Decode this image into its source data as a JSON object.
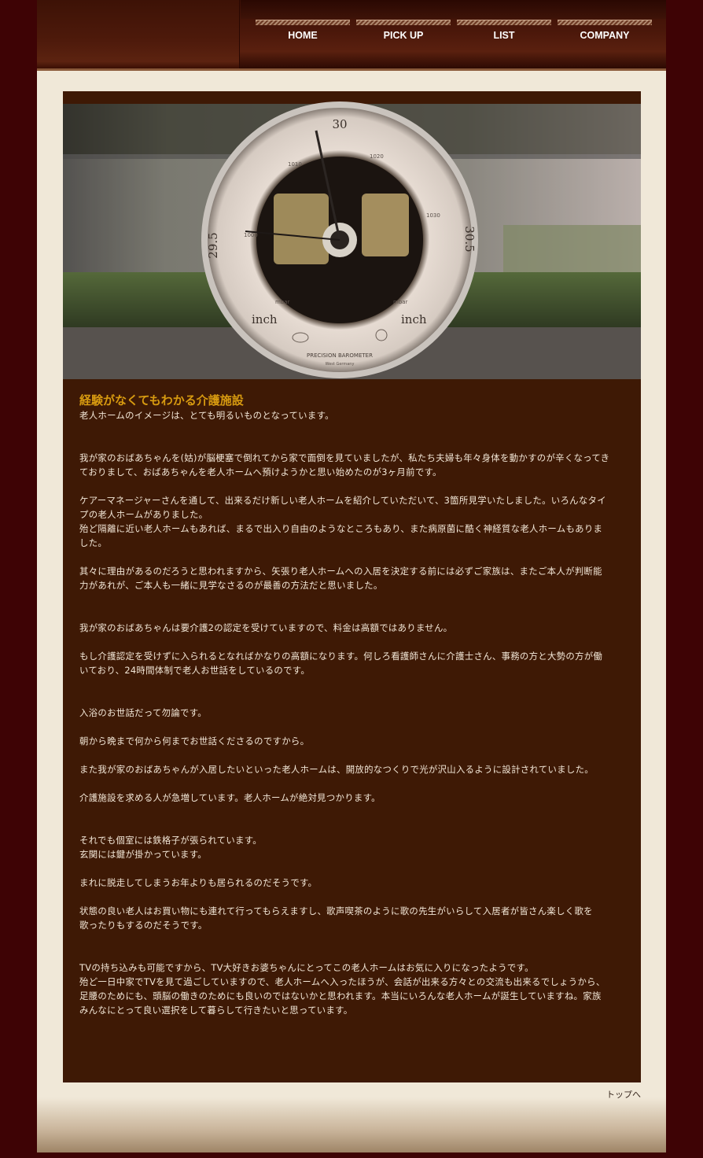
{
  "nav": {
    "items": [
      {
        "label": "HOME"
      },
      {
        "label": "PICK UP"
      },
      {
        "label": "LIST"
      },
      {
        "label": "COMPANY"
      }
    ]
  },
  "hero": {
    "dial_numbers": {
      "n30": "30",
      "n29_5": "29.5",
      "n30_5": "30.5",
      "n1010": "1010",
      "n1020": "1020",
      "n1000": "1000",
      "n1030": "1030"
    },
    "inch_left": "inch",
    "inch_right": "inch",
    "mbar_left": "mbar",
    "mbar_right": "mbar",
    "caption": "PRECISION   BAROMETER",
    "subcaption": "West Germany"
  },
  "content": {
    "title": "経験がなくてもわかる介護施設",
    "intro": "老人ホームのイメージは、とても明るいものとなっています。",
    "p1": [
      "我が家のおばあちゃんを(姑)が脳梗塞で倒れてから家で面倒を見ていましたが、私たち夫婦も年々身体を動かすのが辛くなってき",
      "ておりまして、おばあちゃんを老人ホームへ預けようかと思い始めたのが3ヶ月前です。"
    ],
    "p2": [
      "ケアーマネージャーさんを通して、出来るだけ新しい老人ホームを紹介していただいて、3箇所見学いたしました。いろんなタイ",
      "プの老人ホームがありました。",
      "殆ど隔離に近い老人ホームもあれば、まるで出入り自由のようなところもあり、また病原菌に酷く神経質な老人ホームもありま",
      "した。"
    ],
    "p3": [
      "其々に理由があるのだろうと思われますから、矢張り老人ホームへの入居を決定する前には必ずご家族は、またご本人が判断能",
      "力があれが、ご本人も一緒に見学なさるのが最善の方法だと思いました。"
    ],
    "p4": [
      "我が家のおばあちゃんは要介護2の認定を受けていますので、料金は高額ではありません。"
    ],
    "p5": [
      "もし介護認定を受けずに入られるとなればかなりの高額になります。何しろ看護師さんに介護士さん、事務の方と大勢の方が働",
      "いており、24時間体制で老人お世話をしているのです。"
    ],
    "p6": [
      "入浴のお世話だって勿論です。"
    ],
    "p7": [
      "朝から晩まで何から何までお世話くださるのですから。"
    ],
    "p8": [
      "また我が家のおばあちゃんが入居したいといった老人ホームは、開放的なつくりで光が沢山入るように設計されていました。"
    ],
    "p9": [
      "介護施設を求める人が急増しています。老人ホームが絶対見つかります。"
    ],
    "p10": [
      "それでも個室には鉄格子が張られています。",
      "玄関には鍵が掛かっています。"
    ],
    "p11": [
      "まれに脱走してしまうお年よりも居られるのだそうです。"
    ],
    "p12": [
      "状態の良い老人はお買い物にも連れて行ってもらえますし、歌声喫茶のように歌の先生がいらして入居者が皆さん楽しく歌を",
      "歌ったりもするのだそうです。"
    ],
    "p13": [
      "TVの持ち込みも可能ですから、TV大好きお婆ちゃんにとってこの老人ホームはお気に入りになったようです。",
      "殆ど一日中家でTVを見て過ごしていますので、老人ホームへ入ったほうが、会話が出来る方々との交流も出来るでしょうから、",
      "足腰のためにも、頭脳の働きのためにも良いのではないかと思われます。本当にいろんな老人ホームが誕生していますね。家族",
      "みんなにとって良い選択をして暮らして行きたいと思っています。"
    ]
  },
  "footer": {
    "top_link": "トップへ"
  }
}
